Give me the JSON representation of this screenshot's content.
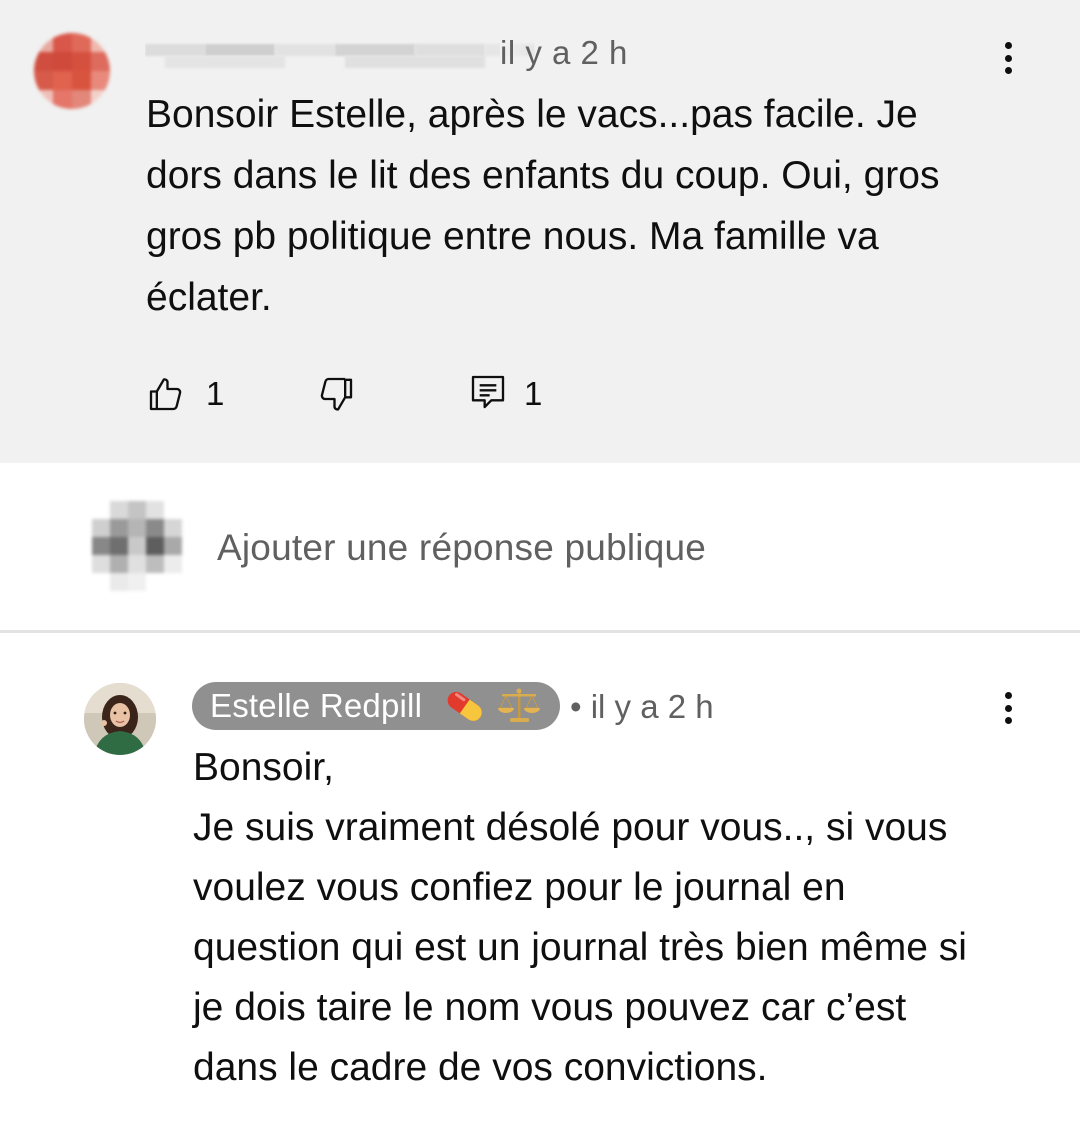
{
  "top_comment": {
    "author_redacted": true,
    "timestamp": "il y a 2 h",
    "text": "Bonsoir Estelle, après le vacs...pas facile. Je\ndors dans le lit des enfants du coup. Oui, gros\ngros pb politique entre nous. Ma famille va\néclater.",
    "like_count": "1",
    "reply_count": "1",
    "icons": {
      "menu": "more-vert-icon",
      "like": "thumb-up-icon",
      "dislike": "thumb-down-icon",
      "reply": "comment-icon"
    }
  },
  "reply_input": {
    "placeholder": "Ajouter une réponse publique"
  },
  "reply": {
    "author": "Estelle Redpill",
    "author_badges": [
      "pill-emoji",
      "scales-emoji"
    ],
    "timestamp": "• il y a 2 h",
    "text": "Bonsoir,\nJe suis vraiment désolé pour vous.., si vous\nvoulez vous confiez pour le journal en\nquestion qui est un journal très bien même si\nje dois taire le nom vous pouvez car c’est\ndans le cadre de vos convictions."
  },
  "colors": {
    "highlight_bg": "#f1f1f1",
    "secondary_text": "#606060",
    "chip_bg": "#909090",
    "primary_text": "#0f0f0f"
  }
}
